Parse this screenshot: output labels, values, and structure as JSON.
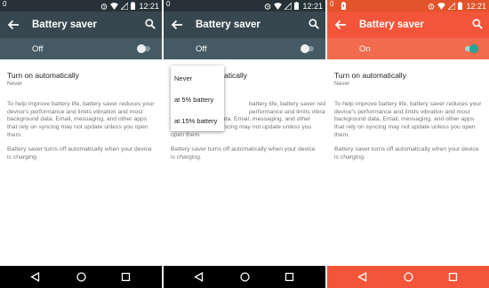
{
  "colors": {
    "status_bar": "#263238",
    "toolbar": "#37474f",
    "switch_bar": "#455a64",
    "saver_status_bar": "#e3532b",
    "saver_toolbar": "#f2553a",
    "saver_switch_bar": "#f26b4f",
    "toggle_on": "#26a69a"
  },
  "panels": [
    {
      "status_time": "12:21",
      "status_left": "0",
      "title": "Battery saver",
      "switch_label": "Off",
      "switch_on": false,
      "setting_title": "Turn on automatically",
      "setting_value": "Never",
      "description": "To help improve battery life, battery saver reduces your device's performance and limits vibration and most background data. Email, messaging, and other apps that rely on syncing may not update unless you open them.",
      "note": "Battery saver turns off automatically when your device is charging."
    },
    {
      "status_time": "12:21",
      "status_left": "0",
      "title": "Battery saver",
      "switch_label": "Off",
      "switch_on": false,
      "setting_title_visible": "atically",
      "description": "battery life, battery saver reduces performance and limits vibration and most background data. Email, messaging, and other apps that rely on syncing may not update unless you open them.",
      "description_line1": "battery life, battery saver reduces",
      "description_line2": "performance and limits vibration and",
      "description_rest": "most background data. Email, messaging, and other apps that rely on syncing may not update unless you open them.",
      "note": "Battery saver turns off automatically when your device is charging.",
      "dropdown_options": [
        "Never",
        "at 5% battery",
        "at 15% battery"
      ]
    },
    {
      "status_time": "12:21",
      "status_left": "0",
      "title": "Battery saver",
      "switch_label": "On",
      "switch_on": true,
      "setting_title": "Turn on automatically",
      "setting_value": "Never",
      "description": "To help improve battery life, battery saver reduces your device's performance and limits vibration and most background data. Email, messaging, and other apps that rely on syncing may not update unless you open them.",
      "note": "Battery saver turns off automatically when your device is charging."
    }
  ],
  "icons": {
    "back": "arrow-back-icon",
    "search": "search-icon",
    "nav_back": "triangle-back-icon",
    "nav_home": "circle-home-icon",
    "nav_recents": "square-recents-icon"
  }
}
